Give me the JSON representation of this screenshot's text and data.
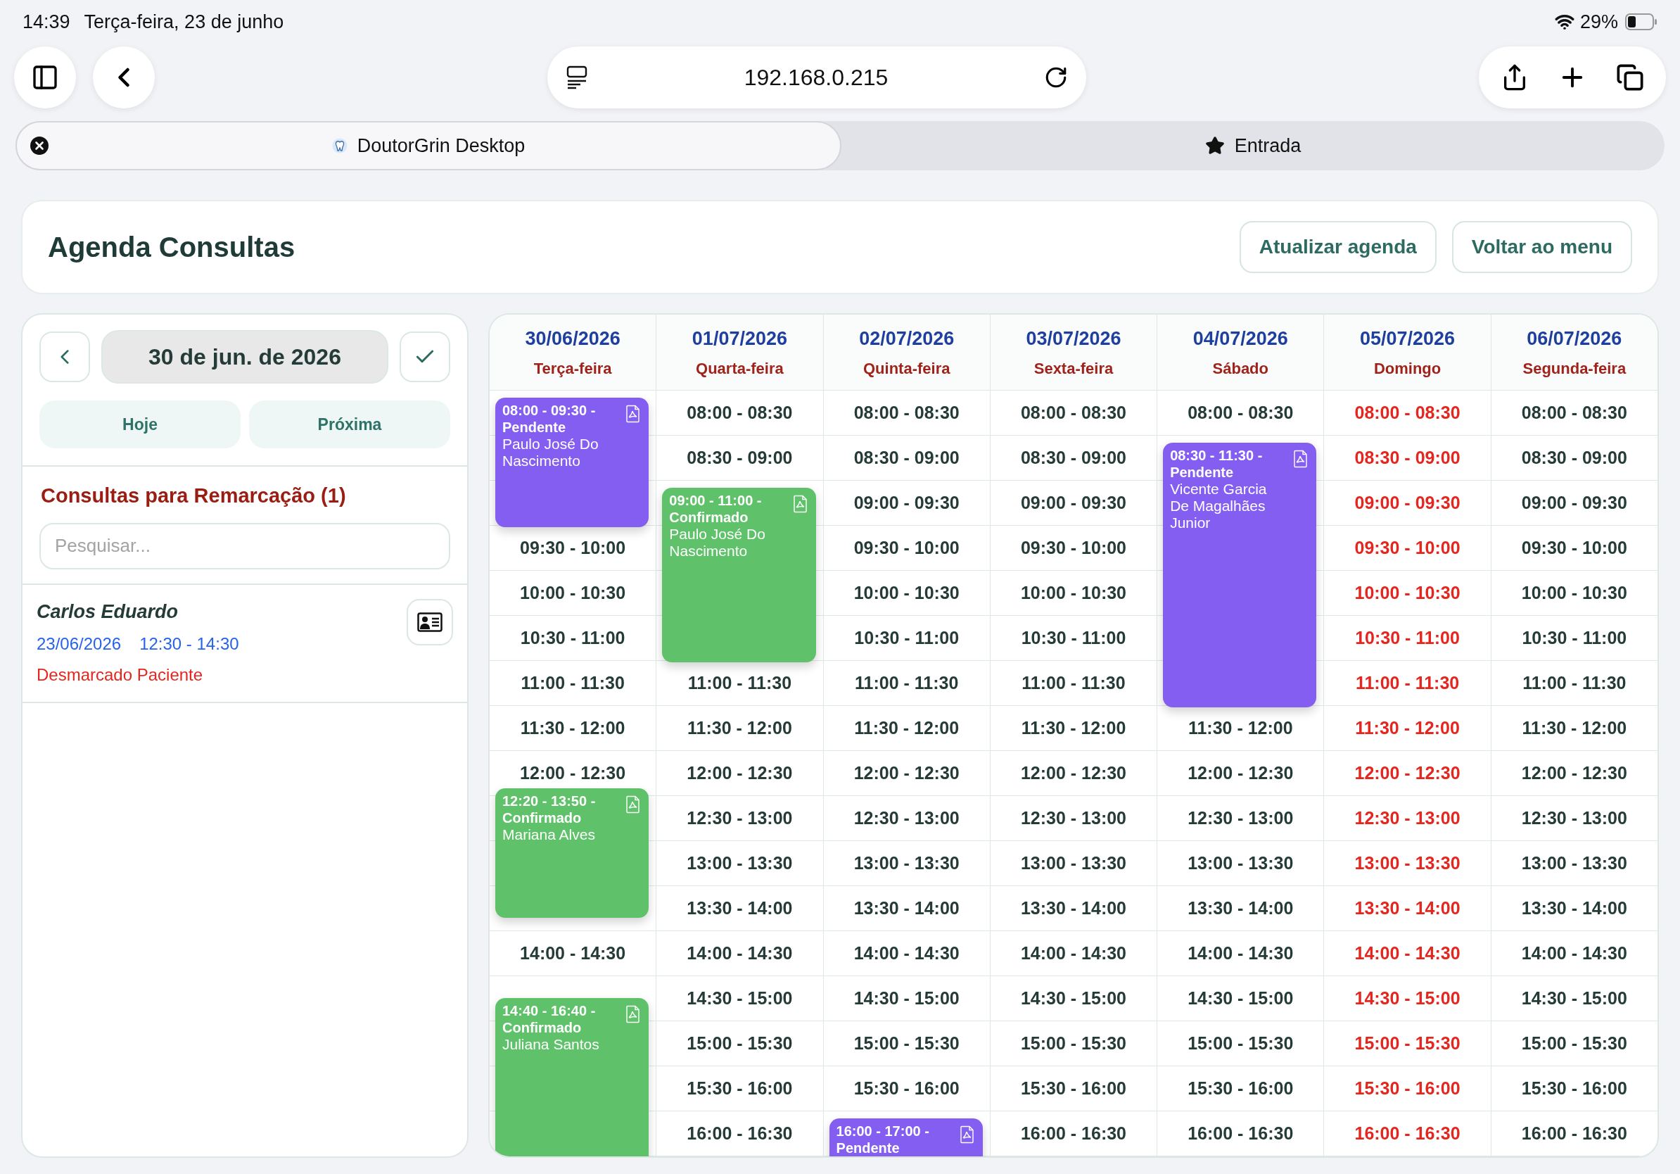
{
  "status_bar": {
    "time": "14:39",
    "date": "Terça-feira, 23 de junho",
    "battery": "29%"
  },
  "browser": {
    "url": "192.168.0.215",
    "tabs": [
      {
        "title": "DoutorGrin Desktop",
        "selected": true
      },
      {
        "title": "Entrada",
        "selected": false
      }
    ]
  },
  "header": {
    "title": "Agenda Consultas",
    "buttons": [
      "Atualizar agenda",
      "Voltar ao menu"
    ]
  },
  "sidebar": {
    "date": "30 de jun. de 2026",
    "buttons": [
      "Hoje",
      "Próxima"
    ],
    "section_title": "Consultas para Remarcação (1)",
    "search": {
      "placeholder": "Pesquisar..."
    },
    "items": [
      {
        "name": "Carlos Eduardo",
        "date": "23/06/2026",
        "time": "12:30 - 14:30",
        "status": "Desmarcado Paciente"
      }
    ]
  },
  "calendar": {
    "columns": [
      {
        "date": "30/06/2026",
        "weekday": "Terça-feira",
        "day_off": false,
        "slots": [
          {
            "kind": "covered"
          },
          {
            "kind": "covered"
          },
          {
            "kind": "covered"
          },
          {
            "kind": "free",
            "time": "09:30 - 10:00"
          },
          {
            "kind": "free",
            "time": "10:00 - 10:30"
          },
          {
            "kind": "free",
            "time": "10:30 - 11:00"
          },
          {
            "kind": "free",
            "time": "11:00 - 11:30"
          },
          {
            "kind": "free",
            "time": "11:30 - 12:00"
          },
          {
            "kind": "free",
            "time": "12:00 - 12:30"
          },
          {
            "kind": "covered"
          },
          {
            "kind": "covered"
          },
          {
            "kind": "covered"
          },
          {
            "kind": "free",
            "time": "14:00 - 14:30"
          },
          {
            "kind": "covered"
          },
          {
            "kind": "covered"
          },
          {
            "kind": "covered"
          },
          {
            "kind": "covered"
          }
        ],
        "events": [
          {
            "heading": "08:00 - 09:30 - Pendente",
            "name": "Paulo José Do Nascimento",
            "kind": "pending"
          },
          {
            "heading": "12:20 - 13:50 - Confirmado",
            "name": "Mariana Alves",
            "kind": "confirmed"
          },
          {
            "heading": "14:40 - 16:40 - Confirmado",
            "name": "Juliana Santos",
            "kind": "confirmed"
          }
        ]
      },
      {
        "date": "01/07/2026",
        "weekday": "Quarta-feira",
        "day_off": false,
        "slots": [
          {
            "kind": "free",
            "time": "08:00 - 08:30"
          },
          {
            "kind": "free",
            "time": "08:30 - 09:00"
          },
          {
            "kind": "covered"
          },
          {
            "kind": "covered"
          },
          {
            "kind": "covered"
          },
          {
            "kind": "covered"
          },
          {
            "kind": "free",
            "time": "11:00 - 11:30"
          },
          {
            "kind": "free",
            "time": "11:30 - 12:00"
          },
          {
            "kind": "free",
            "time": "12:00 - 12:30"
          },
          {
            "kind": "free",
            "time": "12:30 - 13:00"
          },
          {
            "kind": "free",
            "time": "13:00 - 13:30"
          },
          {
            "kind": "free",
            "time": "13:30 - 14:00"
          },
          {
            "kind": "free",
            "time": "14:00 - 14:30"
          },
          {
            "kind": "free",
            "time": "14:30 - 15:00"
          },
          {
            "kind": "free",
            "time": "15:00 - 15:30"
          },
          {
            "kind": "free",
            "time": "15:30 - 16:00"
          },
          {
            "kind": "free",
            "time": "16:00 - 16:30"
          }
        ],
        "events": [
          {
            "heading": "09:00 - 11:00 - Confirmado",
            "name": "Paulo José Do Nascimento",
            "kind": "confirmed"
          }
        ]
      },
      {
        "date": "02/07/2026",
        "weekday": "Quinta-feira",
        "day_off": false,
        "slots": [
          {
            "kind": "free",
            "time": "08:00 - 08:30"
          },
          {
            "kind": "free",
            "time": "08:30 - 09:00"
          },
          {
            "kind": "free",
            "time": "09:00 - 09:30"
          },
          {
            "kind": "free",
            "time": "09:30 - 10:00"
          },
          {
            "kind": "free",
            "time": "10:00 - 10:30"
          },
          {
            "kind": "free",
            "time": "10:30 - 11:00"
          },
          {
            "kind": "free",
            "time": "11:00 - 11:30"
          },
          {
            "kind": "free",
            "time": "11:30 - 12:00"
          },
          {
            "kind": "free",
            "time": "12:00 - 12:30"
          },
          {
            "kind": "free",
            "time": "12:30 - 13:00"
          },
          {
            "kind": "free",
            "time": "13:00 - 13:30"
          },
          {
            "kind": "free",
            "time": "13:30 - 14:00"
          },
          {
            "kind": "free",
            "time": "14:00 - 14:30"
          },
          {
            "kind": "free",
            "time": "14:30 - 15:00"
          },
          {
            "kind": "free",
            "time": "15:00 - 15:30"
          },
          {
            "kind": "free",
            "time": "15:30 - 16:00"
          },
          {
            "kind": "covered"
          }
        ],
        "events": [
          {
            "heading": "16:00 - 17:00 - Pendente",
            "kind": "pending"
          }
        ]
      },
      {
        "date": "03/07/2026",
        "weekday": "Sexta-feira",
        "day_off": false,
        "slots": [
          {
            "kind": "free",
            "time": "08:00 - 08:30"
          },
          {
            "kind": "free",
            "time": "08:30 - 09:00"
          },
          {
            "kind": "free",
            "time": "09:00 - 09:30"
          },
          {
            "kind": "free",
            "time": "09:30 - 10:00"
          },
          {
            "kind": "free",
            "time": "10:00 - 10:30"
          },
          {
            "kind": "free",
            "time": "10:30 - 11:00"
          },
          {
            "kind": "free",
            "time": "11:00 - 11:30"
          },
          {
            "kind": "free",
            "time": "11:30 - 12:00"
          },
          {
            "kind": "free",
            "time": "12:00 - 12:30"
          },
          {
            "kind": "free",
            "time": "12:30 - 13:00"
          },
          {
            "kind": "free",
            "time": "13:00 - 13:30"
          },
          {
            "kind": "free",
            "time": "13:30 - 14:00"
          },
          {
            "kind": "free",
            "time": "14:00 - 14:30"
          },
          {
            "kind": "free",
            "time": "14:30 - 15:00"
          },
          {
            "kind": "free",
            "time": "15:00 - 15:30"
          },
          {
            "kind": "free",
            "time": "15:30 - 16:00"
          },
          {
            "kind": "free",
            "time": "16:00 - 16:30"
          }
        ]
      },
      {
        "date": "04/07/2026",
        "weekday": "Sábado",
        "day_off": false,
        "slots": [
          {
            "kind": "free",
            "time": "08:00 - 08:30"
          },
          {
            "kind": "covered"
          },
          {
            "kind": "covered"
          },
          {
            "kind": "covered"
          },
          {
            "kind": "covered"
          },
          {
            "kind": "covered"
          },
          {
            "kind": "covered"
          },
          {
            "kind": "free",
            "time": "11:30 - 12:00"
          },
          {
            "kind": "free",
            "time": "12:00 - 12:30"
          },
          {
            "kind": "free",
            "time": "12:30 - 13:00"
          },
          {
            "kind": "free",
            "time": "13:00 - 13:30"
          },
          {
            "kind": "free",
            "time": "13:30 - 14:00"
          },
          {
            "kind": "free",
            "time": "14:00 - 14:30"
          },
          {
            "kind": "free",
            "time": "14:30 - 15:00"
          },
          {
            "kind": "free",
            "time": "15:00 - 15:30"
          },
          {
            "kind": "free",
            "time": "15:30 - 16:00"
          },
          {
            "kind": "free",
            "time": "16:00 - 16:30"
          }
        ],
        "events": [
          {
            "heading": "08:30 - 11:30 - Pendente",
            "name": "Vicente Garcia De Magalhães Junior",
            "kind": "pending"
          }
        ]
      },
      {
        "date": "05/07/2026",
        "weekday": "Domingo",
        "day_off": true,
        "slots": [
          {
            "kind": "free",
            "time": "08:00 - 08:30"
          },
          {
            "kind": "free",
            "time": "08:30 - 09:00"
          },
          {
            "kind": "free",
            "time": "09:00 - 09:30"
          },
          {
            "kind": "free",
            "time": "09:30 - 10:00"
          },
          {
            "kind": "free",
            "time": "10:00 - 10:30"
          },
          {
            "kind": "free",
            "time": "10:30 - 11:00"
          },
          {
            "kind": "free",
            "time": "11:00 - 11:30"
          },
          {
            "kind": "free",
            "time": "11:30 - 12:00"
          },
          {
            "kind": "free",
            "time": "12:00 - 12:30"
          },
          {
            "kind": "free",
            "time": "12:30 - 13:00"
          },
          {
            "kind": "free",
            "time": "13:00 - 13:30"
          },
          {
            "kind": "free",
            "time": "13:30 - 14:00"
          },
          {
            "kind": "free",
            "time": "14:00 - 14:30"
          },
          {
            "kind": "free",
            "time": "14:30 - 15:00"
          },
          {
            "kind": "free",
            "time": "15:00 - 15:30"
          },
          {
            "kind": "free",
            "time": "15:30 - 16:00"
          },
          {
            "kind": "free",
            "time": "16:00 - 16:30"
          }
        ]
      },
      {
        "date": "06/07/2026",
        "weekday": "Segunda-feira",
        "day_off": false,
        "slots": [
          {
            "kind": "free",
            "time": "08:00 - 08:30"
          },
          {
            "kind": "free",
            "time": "08:30 - 09:00"
          },
          {
            "kind": "free",
            "time": "09:00 - 09:30"
          },
          {
            "kind": "free",
            "time": "09:30 - 10:00"
          },
          {
            "kind": "free",
            "time": "10:00 - 10:30"
          },
          {
            "kind": "free",
            "time": "10:30 - 11:00"
          },
          {
            "kind": "free",
            "time": "11:00 - 11:30"
          },
          {
            "kind": "free",
            "time": "11:30 - 12:00"
          },
          {
            "kind": "free",
            "time": "12:00 - 12:30"
          },
          {
            "kind": "free",
            "time": "12:30 - 13:00"
          },
          {
            "kind": "free",
            "time": "13:00 - 13:30"
          },
          {
            "kind": "free",
            "time": "13:30 - 14:00"
          },
          {
            "kind": "free",
            "time": "14:00 - 14:30"
          },
          {
            "kind": "free",
            "time": "14:30 - 15:00"
          },
          {
            "kind": "free",
            "time": "15:00 - 15:30"
          },
          {
            "kind": "free",
            "time": "15:30 - 16:00"
          },
          {
            "kind": "free",
            "time": "16:00 - 16:30"
          }
        ]
      }
    ]
  }
}
